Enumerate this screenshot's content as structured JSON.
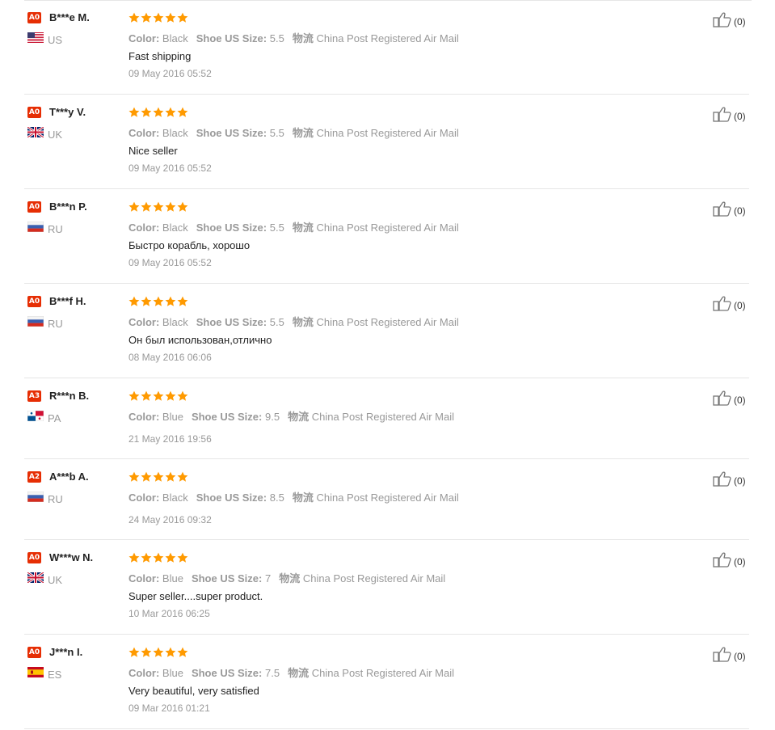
{
  "labels": {
    "color": "Color:",
    "size": "Shoe US Size:",
    "logistics": "物流"
  },
  "colors": {
    "badge": "#e62e04",
    "star": "#ff9a00",
    "muted": "#999999"
  },
  "reviews": [
    {
      "badge": "A0",
      "user": "B***e M.",
      "flag": "us-flag-icon",
      "country": "US",
      "color": "Black",
      "size": "5.5",
      "shipping": "China Post Registered Air Mail",
      "comment": "Fast shipping",
      "date": "09 May 2016 05:52",
      "helpful": "(0)",
      "stars": 5
    },
    {
      "badge": "A0",
      "user": "T***y V.",
      "flag": "uk-flag-icon",
      "country": "UK",
      "color": "Black",
      "size": "5.5",
      "shipping": "China Post Registered Air Mail",
      "comment": "Nice seller",
      "date": "09 May 2016 05:52",
      "helpful": "(0)",
      "stars": 5
    },
    {
      "badge": "A0",
      "user": "B***n P.",
      "flag": "ru-flag-icon",
      "country": "RU",
      "color": "Black",
      "size": "5.5",
      "shipping": "China Post Registered Air Mail",
      "comment": "Быстро корабль, хорошо",
      "date": "09 May 2016 05:52",
      "helpful": "(0)",
      "stars": 5
    },
    {
      "badge": "A0",
      "user": "B***f H.",
      "flag": "ru-flag-icon",
      "country": "RU",
      "color": "Black",
      "size": "5.5",
      "shipping": "China Post Registered Air Mail",
      "comment": "Он был использован,отлично",
      "date": "08 May 2016 06:06",
      "helpful": "(0)",
      "stars": 5
    },
    {
      "badge": "A3",
      "user": "R***n B.",
      "flag": "pa-flag-icon",
      "country": "PA",
      "color": "Blue",
      "size": "9.5",
      "shipping": "China Post Registered Air Mail",
      "comment": "",
      "date": "21 May 2016 19:56",
      "helpful": "(0)",
      "stars": 5
    },
    {
      "badge": "A2",
      "user": "A***b A.",
      "flag": "ru-flag-icon",
      "country": "RU",
      "color": "Black",
      "size": "8.5",
      "shipping": "China Post Registered Air Mail",
      "comment": "",
      "date": "24 May 2016 09:32",
      "helpful": "(0)",
      "stars": 5
    },
    {
      "badge": "A0",
      "user": "W***w N.",
      "flag": "uk-flag-icon",
      "country": "UK",
      "color": "Blue",
      "size": "7",
      "shipping": "China Post Registered Air Mail",
      "comment": "Super seller....super product.",
      "date": "10 Mar 2016 06:25",
      "helpful": "(0)",
      "stars": 5
    },
    {
      "badge": "A0",
      "user": "J***n I.",
      "flag": "es-flag-icon",
      "country": "ES",
      "color": "Blue",
      "size": "7.5",
      "shipping": "China Post Registered Air Mail",
      "comment": "Very beautiful, very satisfied",
      "date": "09 Mar 2016 01:21",
      "helpful": "(0)",
      "stars": 5
    }
  ]
}
